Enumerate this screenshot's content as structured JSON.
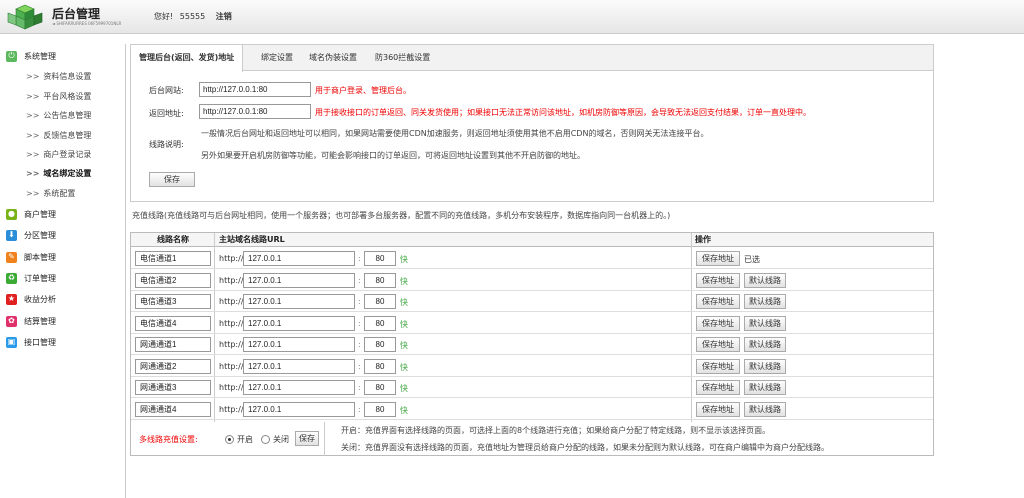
{
  "header": {
    "brand_title": "后台管理",
    "brand_sub": "◄ SHIFARRURRES 06F5999701NLR",
    "welcome_prefix": "您好!",
    "username": "55555",
    "logout_label": "注销"
  },
  "sidebar": {
    "groups": [
      {
        "label": "系统管理",
        "icon": "power-icon",
        "color": "#5cb85c"
      },
      {
        "label": "商户管理",
        "icon": "user-icon",
        "color": "#7ab317"
      },
      {
        "label": "分区管理",
        "icon": "download-icon",
        "color": "#2a8fd8"
      },
      {
        "label": "脚本管理",
        "icon": "pencil-icon",
        "color": "#f0821e"
      },
      {
        "label": "订单管理",
        "icon": "recycle-icon",
        "color": "#3aaa35"
      },
      {
        "label": "收益分析",
        "icon": "star-icon",
        "color": "#e02020"
      },
      {
        "label": "结算管理",
        "icon": "settings-icon",
        "color": "#e0306a"
      },
      {
        "label": "接口管理",
        "icon": "monitor-icon",
        "color": "#2a9be8"
      }
    ],
    "sub_items": [
      {
        "label": "资料信息设置"
      },
      {
        "label": "平台风格设置"
      },
      {
        "label": "公告信息管理"
      },
      {
        "label": "反馈信息管理"
      },
      {
        "label": "商户登录记录"
      },
      {
        "label": "域名绑定设置"
      },
      {
        "label": "系统配置"
      }
    ],
    "sub_prefix": ">>"
  },
  "tabs": [
    {
      "label": "管理后台(返回、发货)地址"
    },
    {
      "label": "绑定设置"
    },
    {
      "label": "域名伪装设置"
    },
    {
      "label": "防360拦截设置"
    }
  ],
  "form": {
    "backend_label": "后台网站:",
    "backend_value": "http://127.0.0.1:80",
    "backend_hint": "用于商户登录、管理后台。",
    "return_label": "返回地址:",
    "return_value": "http://127.0.0.1:80",
    "return_hint": "用于接收接口的订单返回、同关发货使用；如果接口无法正常访问该地址，如机房防御等原因，会导致无法返回支付结果，订单一直处理中。",
    "desc_label": "线路说明:",
    "desc_line1": "一般情况后台网址和返回地址可以相同，如果网站需要使用CDN加速服务，则返回地址须使用其他不启用CDN的域名，否则网关无法连接平台。",
    "desc_line2": "另外如果要开启机房防御等功能，可能会影响接口的订单返回，可将返回地址设置到其他不开启防御的地址。",
    "save_label": "保存"
  },
  "recharge_note": "充值线路(充值线路可与后台网址相同，使用一个服务器；也可部署多台服务器，配置不同的充值线路，多机分布安装程序，数据库指向同一台机器上的。)",
  "table": {
    "headers": {
      "name": "线路名称",
      "url": "主站域名线路URL",
      "action": "操作"
    },
    "proto": "http://",
    "save_addr_label": "保存地址",
    "default_label": "默认线路",
    "rows": [
      {
        "name": "电信通道1",
        "host": "127.0.0.1",
        "port": "80",
        "speed": "快",
        "status": "已选"
      },
      {
        "name": "电信通道2",
        "host": "127.0.0.1",
        "port": "80",
        "speed": "快",
        "status": ""
      },
      {
        "name": "电信通道3",
        "host": "127.0.0.1",
        "port": "80",
        "speed": "快",
        "status": ""
      },
      {
        "name": "电信通道4",
        "host": "127.0.0.1",
        "port": "80",
        "speed": "快",
        "status": ""
      },
      {
        "name": "网通通道1",
        "host": "127.0.0.1",
        "port": "80",
        "speed": "快",
        "status": ""
      },
      {
        "name": "网通通道2",
        "host": "127.0.0.1",
        "port": "80",
        "speed": "快",
        "status": ""
      },
      {
        "name": "网通通道3",
        "host": "127.0.0.1",
        "port": "80",
        "speed": "快",
        "status": ""
      },
      {
        "name": "网通通道4",
        "host": "127.0.0.1",
        "port": "80",
        "speed": "快",
        "status": ""
      }
    ],
    "multi": {
      "label": "多线路充值设置:",
      "on_label": "开启",
      "off_label": "关闭",
      "save_label": "保存",
      "on_desc": "开启：充值界面有选择线路的页面，可选择上面的8个线路进行充值；如果给商户分配了特定线路，则不显示该选择页面。",
      "off_desc": "关闭：充值界面没有选择线路的页面，充值地址为管理员给商户分配的线路，如果未分配则为默认线路，可在商户编辑中为商户分配线路。"
    }
  }
}
